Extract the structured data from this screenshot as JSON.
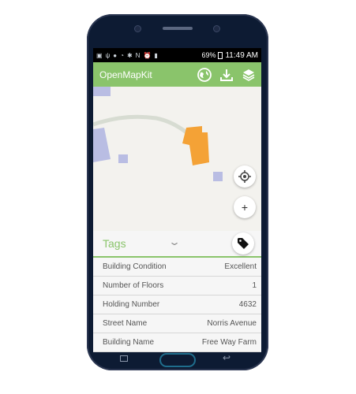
{
  "statusbar": {
    "battery": "69%",
    "time": "11:49 AM"
  },
  "app": {
    "title": "OpenMapKit",
    "accent": "#8ac46b"
  },
  "map": {
    "building_color": "#f4a236",
    "landuse_color": "#b9bde3",
    "path_color": "#d7dcd2"
  },
  "map_controls": {
    "zoom_in_label": "+"
  },
  "tags": {
    "heading": "Tags",
    "rows": [
      {
        "label": "Building Condition",
        "value": "Excellent"
      },
      {
        "label": "Number of Floors",
        "value": "1"
      },
      {
        "label": "Holding Number",
        "value": "4632"
      },
      {
        "label": "Street Name",
        "value": "Norris Avenue"
      },
      {
        "label": "Building Name",
        "value": "Free Way Farm"
      }
    ]
  },
  "icons": {
    "globe": "globe-icon",
    "download": "download-icon",
    "layers": "layers-icon",
    "locate": "locate-icon",
    "tag": "tag-icon"
  }
}
